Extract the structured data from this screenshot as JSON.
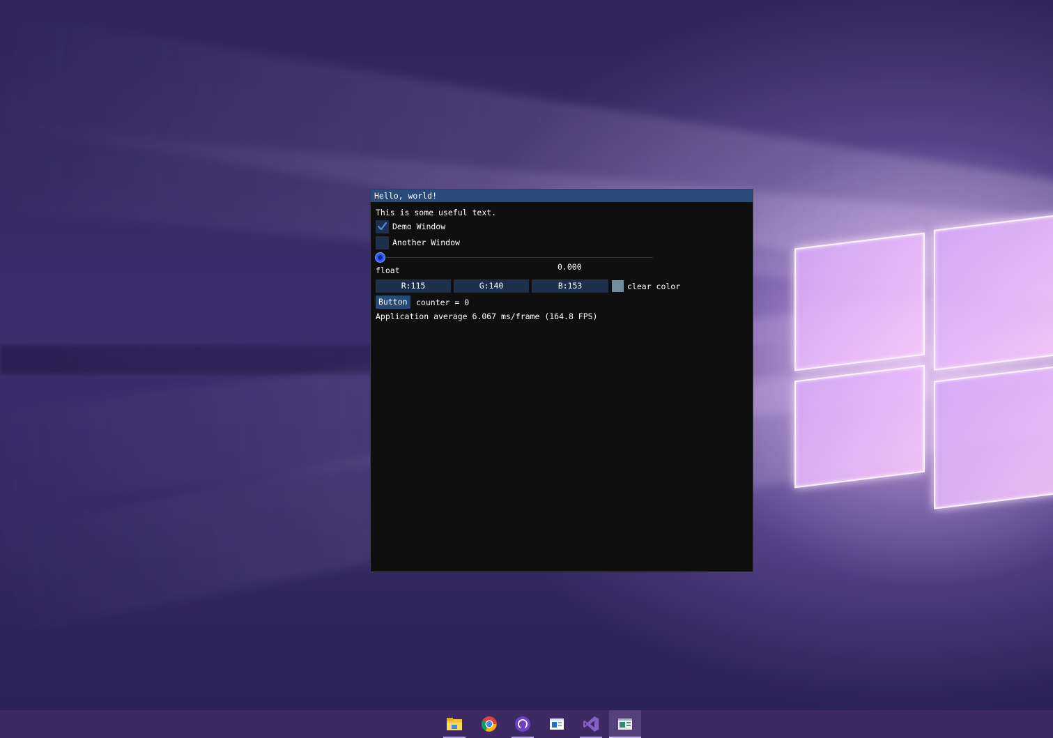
{
  "window": {
    "title": "Hello, world!",
    "text": "This is some useful text.",
    "checkboxes": [
      {
        "label": "Demo Window",
        "checked": true
      },
      {
        "label": "Another Window",
        "checked": false
      }
    ],
    "slider": {
      "value": "0.000",
      "label": "float",
      "fraction": 0.0
    },
    "color_edit": {
      "r": "R:115",
      "g": "G:140",
      "b": "B:153",
      "label": "clear color",
      "swatch_color": "#738c99"
    },
    "button_label": "Button",
    "counter_text": "counter = 0",
    "framerate_text": "Application average 6.067 ms/frame (164.8 FPS)"
  },
  "colors": {
    "title_bar": "#294a7a",
    "window_bg": "#0f0f0f",
    "frame_bg": "#1d2f4a",
    "accent": "#2f5bff",
    "taskbar": "#3e2a63"
  },
  "taskbar": {
    "items": [
      {
        "icon": "file-explorer-icon",
        "running": true,
        "active": false
      },
      {
        "icon": "chrome-icon",
        "running": false,
        "active": false
      },
      {
        "icon": "github-desktop-icon",
        "running": true,
        "active": false
      },
      {
        "icon": "app-window-icon",
        "running": false,
        "active": false
      },
      {
        "icon": "visual-studio-icon",
        "running": true,
        "active": false
      },
      {
        "icon": "imgui-app-icon",
        "running": true,
        "active": true
      }
    ]
  }
}
